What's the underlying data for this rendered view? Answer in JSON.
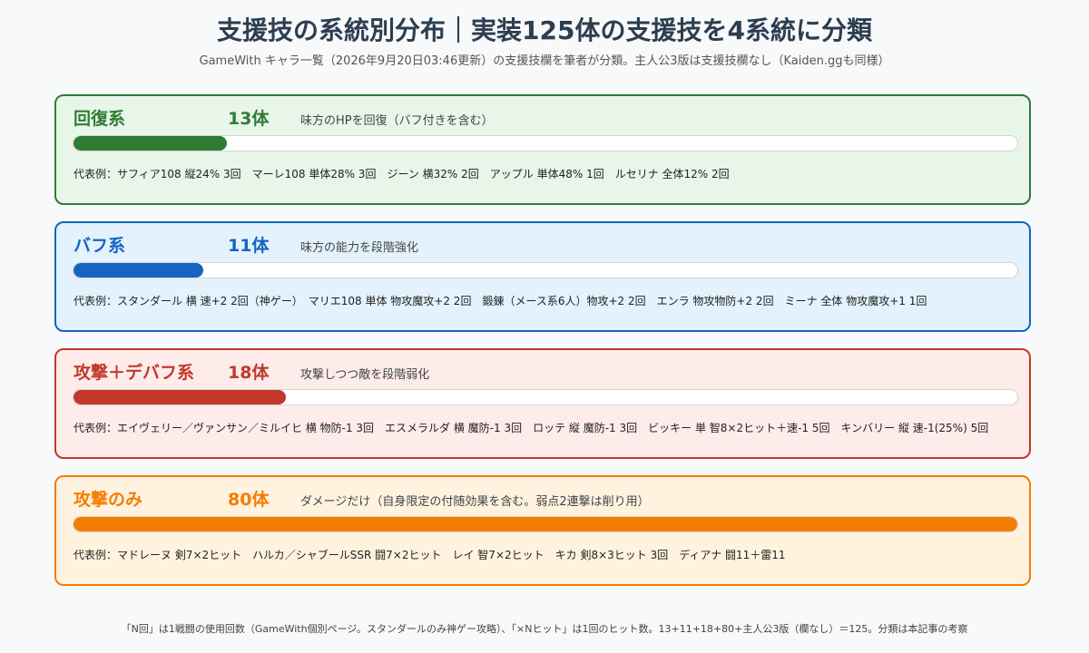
{
  "title": "支援技の系統別分布｜実装125体の支援技を4系統に分類",
  "subtitle": "GameWith キャラ一覧（2026年9月20日03:46更新）の支援技欄を筆者が分類。主人公3版は支援技欄なし（Kaiden.ggも同様）",
  "footnote": "「N回」は1戦闘の使用回数（GameWith個別ページ。スタンダールのみ神ゲー攻略）、「×Nヒット」は1回のヒット数。13+11+18+80+主人公3版（欄なし）＝125。分類は本記事の考察",
  "colors": {
    "heal": "#2e7d32",
    "buff": "#1565c0",
    "debuff": "#c0392b",
    "attack": "#f57c00"
  },
  "chart_data": {
    "type": "bar",
    "orientation": "horizontal",
    "xlim": [
      0,
      80
    ],
    "categories": [
      "回復系",
      "バフ系",
      "攻撃＋デバフ系",
      "攻撃のみ"
    ],
    "values": [
      13,
      11,
      18,
      80
    ],
    "value_labels": [
      "13体",
      "11体",
      "18体",
      "80体"
    ],
    "descriptions": [
      "味方のHPを回復（バフ付きを含む）",
      "味方の能力を段階強化",
      "攻撃しつつ敵を段階弱化",
      "ダメージだけ（自身限定の付随効果を含む。弱点2連撃は削り用）"
    ],
    "examples": [
      "代表例：サフィア108 縦24% 3回　マーレ108 単体28% 3回　ジーン 横32% 2回　アップル 単体48% 1回　ルセリナ 全体12% 2回",
      "代表例：スタンダール 横 速+2 2回（神ゲー）　マリエ108 単体 物攻魔攻+2 2回　鍛錬（メース系6人）物攻+2 2回　エンラ 物攻物防+2 2回　ミーナ 全体 物攻魔攻+1 1回",
      "代表例：エイヴェリー／ヴァンサン／ミルイヒ 横 物防-1 3回　エスメラルダ 横 魔防-1 3回　ロッテ 縦 魔防-1 3回　ビッキー 単 智8×2ヒット＋速-1 5回　キンバリー 縦 速-1(25%) 5回",
      "代表例：マドレーヌ 剣7×2ヒット　ハルカ／シャブールSSR 闘7×2ヒット　レイ 智7×2ヒット　キカ 剣8×3ヒット 3回　ディアナ 闘11＋雷11"
    ],
    "series_colors": [
      "#2e7d32",
      "#1565c0",
      "#c0392b",
      "#f57c00"
    ],
    "panel_fills": [
      "#e8f5e9",
      "#e3f2fd",
      "#fdecea",
      "#fff3e0"
    ]
  }
}
